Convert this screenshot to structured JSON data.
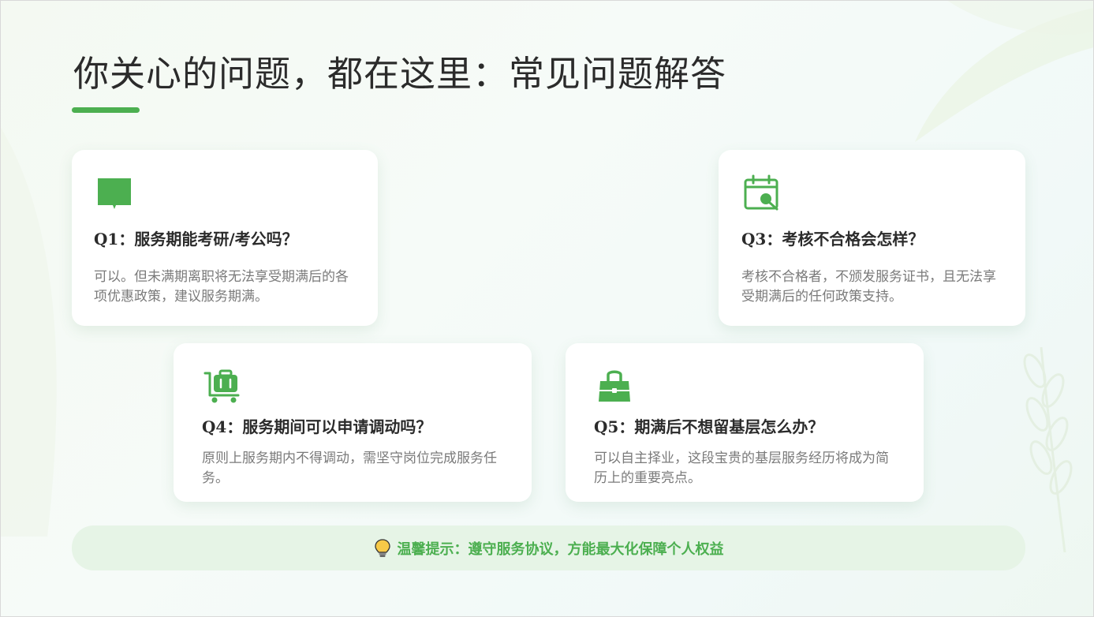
{
  "page": {
    "title": "你关心的问题，都在这里：常见问题解答"
  },
  "colors": {
    "accent": "#4caf50",
    "heading": "#2b2b2b",
    "body_text": "#7a7a7a",
    "tip_bg": "#e6f4e6"
  },
  "cards": [
    {
      "icon": "open-book-icon",
      "question": "Q1：服务期能考研/考公吗？",
      "answer": "可以。但未满期离职将无法享受期满后的各项优惠政策，建议服务期满。"
    },
    {
      "icon": "calendar-search-icon",
      "question": "Q3：考核不合格会怎样？",
      "answer": "考核不合格者，不颁发服务证书，且无法享受期满后的任何政策支持。"
    },
    {
      "icon": "luggage-cart-icon",
      "question": "Q4：服务期间可以申请调动吗？",
      "answer": "原则上服务期内不得调动，需坚守岗位完成服务任务。"
    },
    {
      "icon": "handbag-icon",
      "question": "Q5：期满后不想留基层怎么办？",
      "answer": "可以自主择业，这段宝贵的基层服务经历将成为简历上的重要亮点。"
    }
  ],
  "tip": {
    "icon": "lightbulb-icon",
    "text": "温馨提示：遵守服务协议，方能最大化保障个人权益"
  }
}
